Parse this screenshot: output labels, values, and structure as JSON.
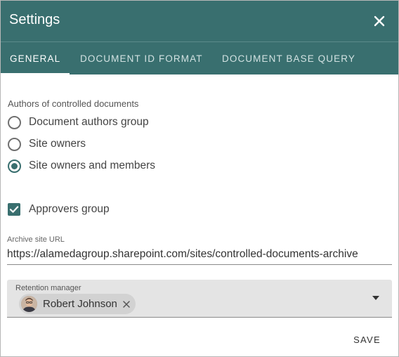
{
  "dialog": {
    "title": "Settings",
    "close_icon": "close-icon",
    "accent_color": "#396f6f"
  },
  "tabs": [
    {
      "label": "GENERAL",
      "active": true
    },
    {
      "label": "DOCUMENT ID FORMAT",
      "active": false
    },
    {
      "label": "DOCUMENT BASE QUERY",
      "active": false
    }
  ],
  "authors": {
    "section_label": "Authors of controlled documents",
    "options": [
      {
        "label": "Document authors group",
        "selected": false
      },
      {
        "label": "Site owners",
        "selected": false
      },
      {
        "label": "Site owners and members",
        "selected": true
      }
    ]
  },
  "approvers": {
    "label": "Approvers group",
    "checked": true
  },
  "archive": {
    "label": "Archive site URL",
    "value": "https://alamedagroup.sharepoint.com/sites/controlled-documents-archive"
  },
  "retention": {
    "label": "Retention manager",
    "chip_label": "Robert Johnson",
    "chip_icon": "avatar",
    "remove_icon": "close-icon",
    "dropdown_icon": "caret-down-icon"
  },
  "actions": {
    "save_label": "SAVE"
  }
}
